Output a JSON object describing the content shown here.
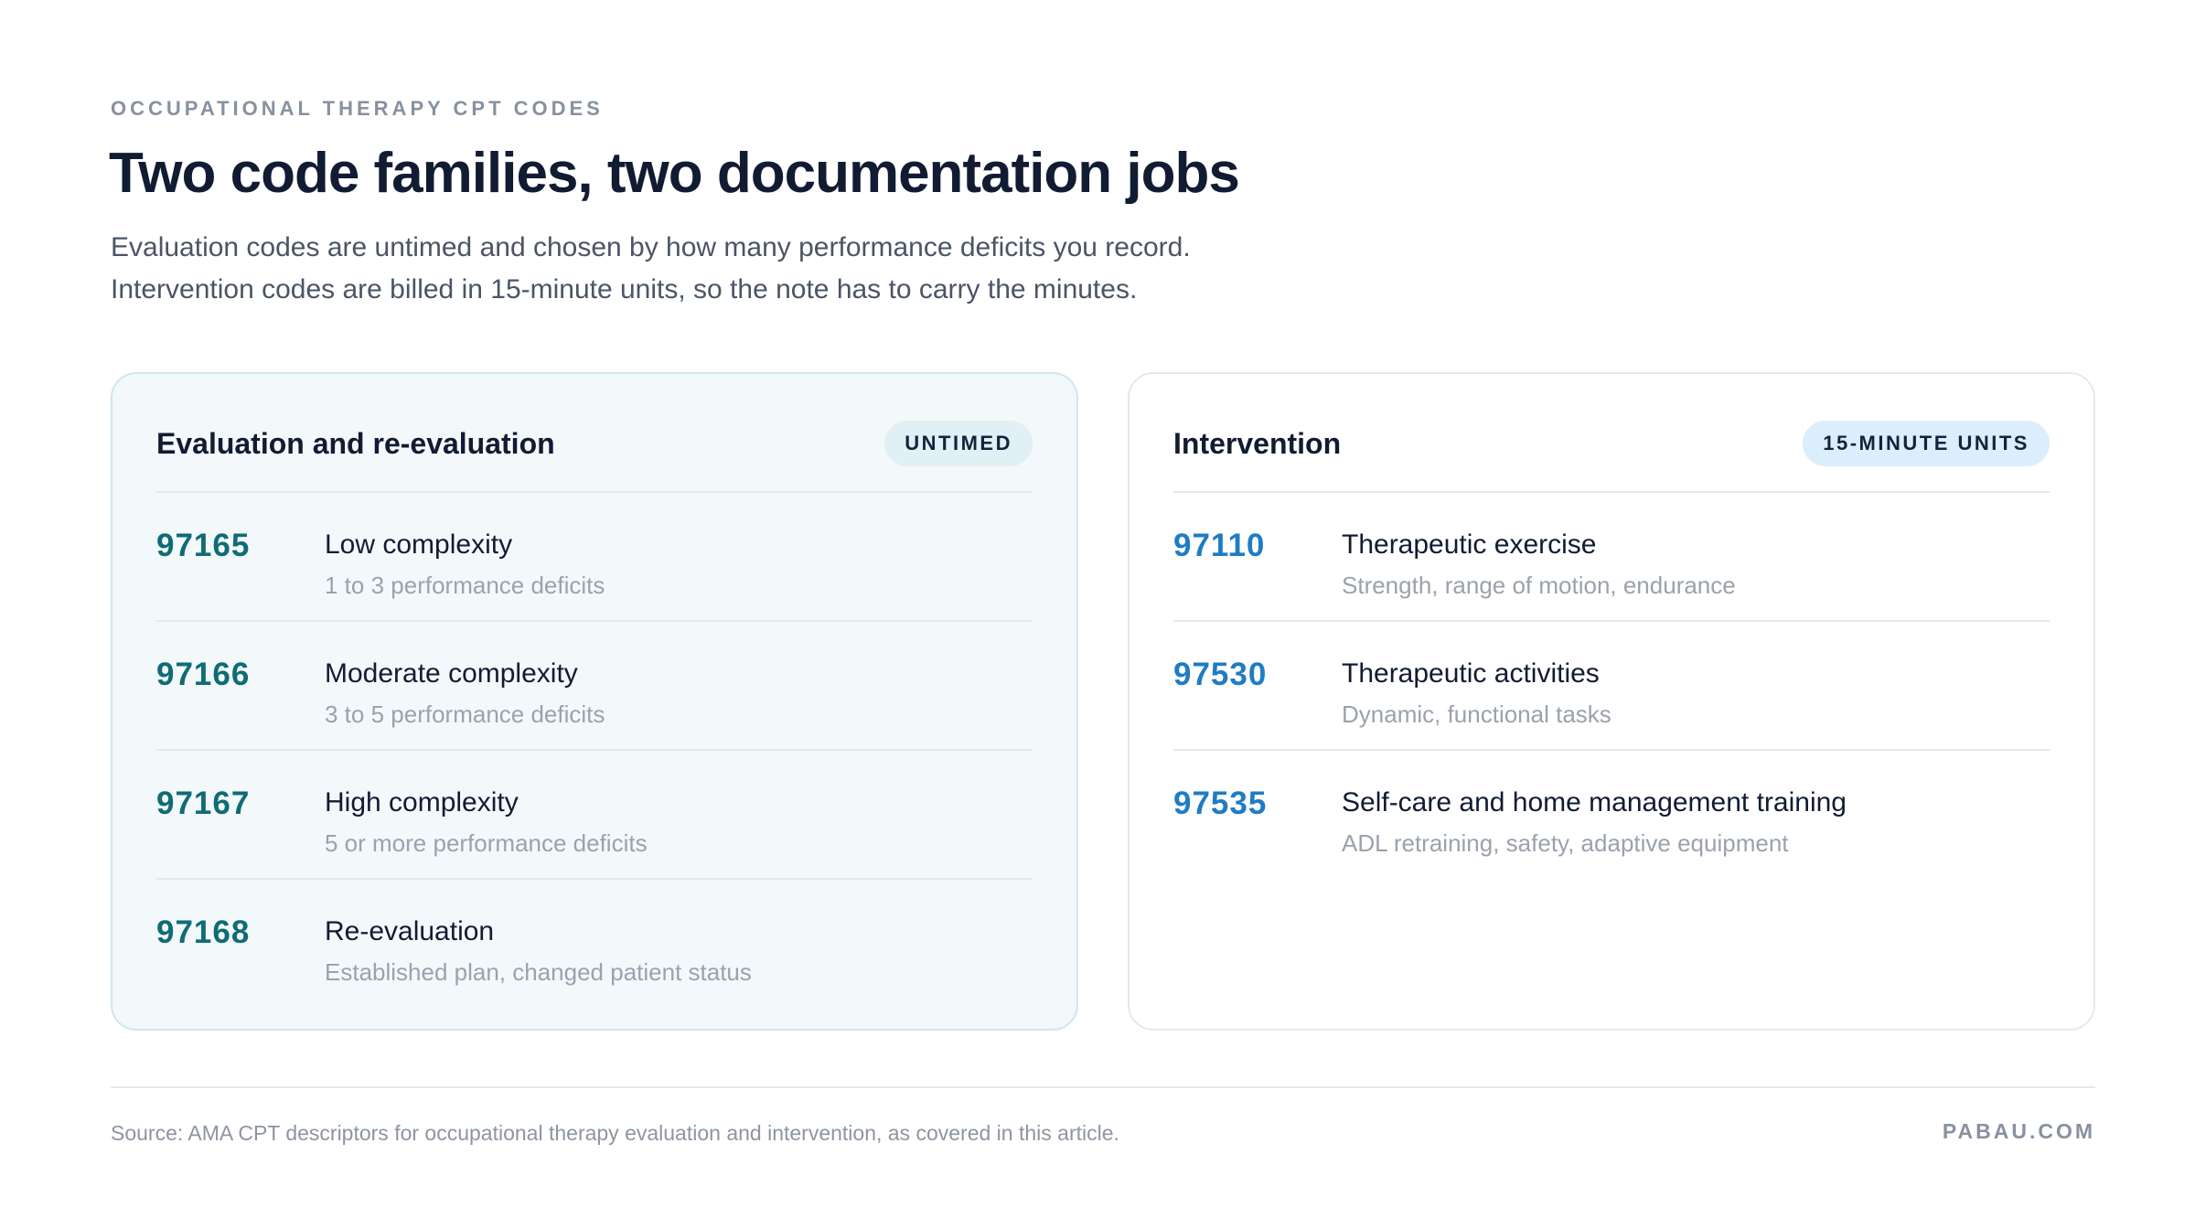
{
  "header": {
    "eyebrow": "OCCUPATIONAL THERAPY CPT CODES",
    "title": "Two code families, two documentation jobs",
    "subtitle_line1": "Evaluation codes are untimed and chosen by how many performance deficits you record.",
    "subtitle_line2": "Intervention codes are billed in 15-minute units, so the note has to carry the minutes."
  },
  "evaluation": {
    "title": "Evaluation and re-evaluation",
    "badge": "UNTIMED",
    "rows": [
      {
        "code": "97165",
        "name": "Low complexity",
        "desc": "1 to 3 performance deficits"
      },
      {
        "code": "97166",
        "name": "Moderate complexity",
        "desc": "3 to 5 performance deficits"
      },
      {
        "code": "97167",
        "name": "High complexity",
        "desc": "5 or more performance deficits"
      },
      {
        "code": "97168",
        "name": "Re-evaluation",
        "desc": "Established plan, changed patient status"
      }
    ]
  },
  "intervention": {
    "title": "Intervention",
    "badge": "15-MINUTE UNITS",
    "rows": [
      {
        "code": "97110",
        "name": "Therapeutic exercise",
        "desc": "Strength, range of motion, endurance"
      },
      {
        "code": "97530",
        "name": "Therapeutic activities",
        "desc": "Dynamic, functional tasks"
      },
      {
        "code": "97535",
        "name": "Self-care and home management training",
        "desc": "ADL retraining, safety, adaptive equipment"
      }
    ]
  },
  "footer": {
    "source": "Source: AMA CPT descriptors for occupational therapy evaluation and intervention, as covered in this article.",
    "brand": "PABAU.COM"
  },
  "colors": {
    "evaluation_code": "#0f6c74",
    "intervention_code": "#1f7cc4",
    "evaluation_card_bg": "#f3f8fb",
    "title": "#111c33"
  }
}
